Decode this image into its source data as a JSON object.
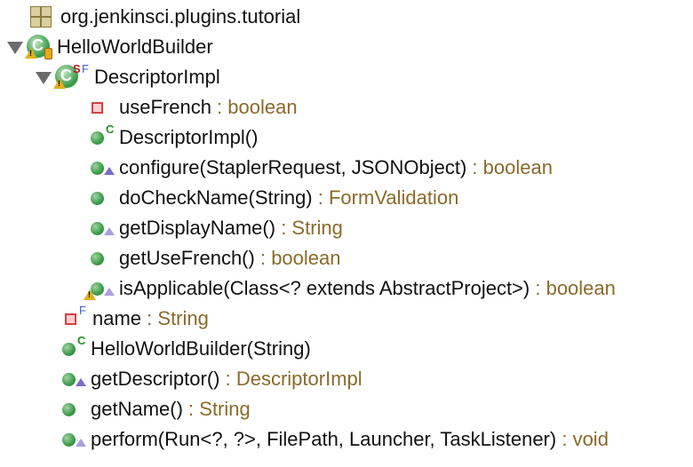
{
  "package": {
    "label": "org.jenkinsci.plugins.tutorial"
  },
  "class_outer": {
    "label": "HelloWorldBuilder"
  },
  "class_inner": {
    "label": "DescriptorImpl"
  },
  "inner_members": [
    {
      "name": "useFrench",
      "type": ": boolean",
      "icon": "private-field-icon"
    },
    {
      "name": "DescriptorImpl()",
      "type": "",
      "icon": "public-constructor-icon"
    },
    {
      "name": "configure(StaplerRequest, JSONObject)",
      "type": ": boolean",
      "icon": "public-method-override-icon"
    },
    {
      "name": "doCheckName(String)",
      "type": ": FormValidation",
      "icon": "public-method-icon"
    },
    {
      "name": "getDisplayName()",
      "type": ": String",
      "icon": "public-method-override-icon"
    },
    {
      "name": "getUseFrench()",
      "type": ": boolean",
      "icon": "public-method-icon"
    },
    {
      "name": "isApplicable(Class<? extends AbstractProject>)",
      "type": ": boolean",
      "icon": "public-method-warning-icon"
    }
  ],
  "outer_members": [
    {
      "name": "name",
      "type": ": String",
      "icon": "private-final-field-icon"
    },
    {
      "name": "HelloWorldBuilder(String)",
      "type": "",
      "icon": "public-constructor-icon"
    },
    {
      "name": "getDescriptor()",
      "type": ": DescriptorImpl",
      "icon": "public-method-override-icon"
    },
    {
      "name": "getName()",
      "type": ": String",
      "icon": "public-method-icon"
    },
    {
      "name": "perform(Run<?, ?>, FilePath, Launcher, TaskListener)",
      "type": ": void",
      "icon": "public-method-override-icon"
    }
  ],
  "colors": {
    "type_text": "#8b6a2b",
    "method_icon": "#3a9a4a",
    "private_icon": "#d64040",
    "final_marker": "#3a5fcf"
  }
}
